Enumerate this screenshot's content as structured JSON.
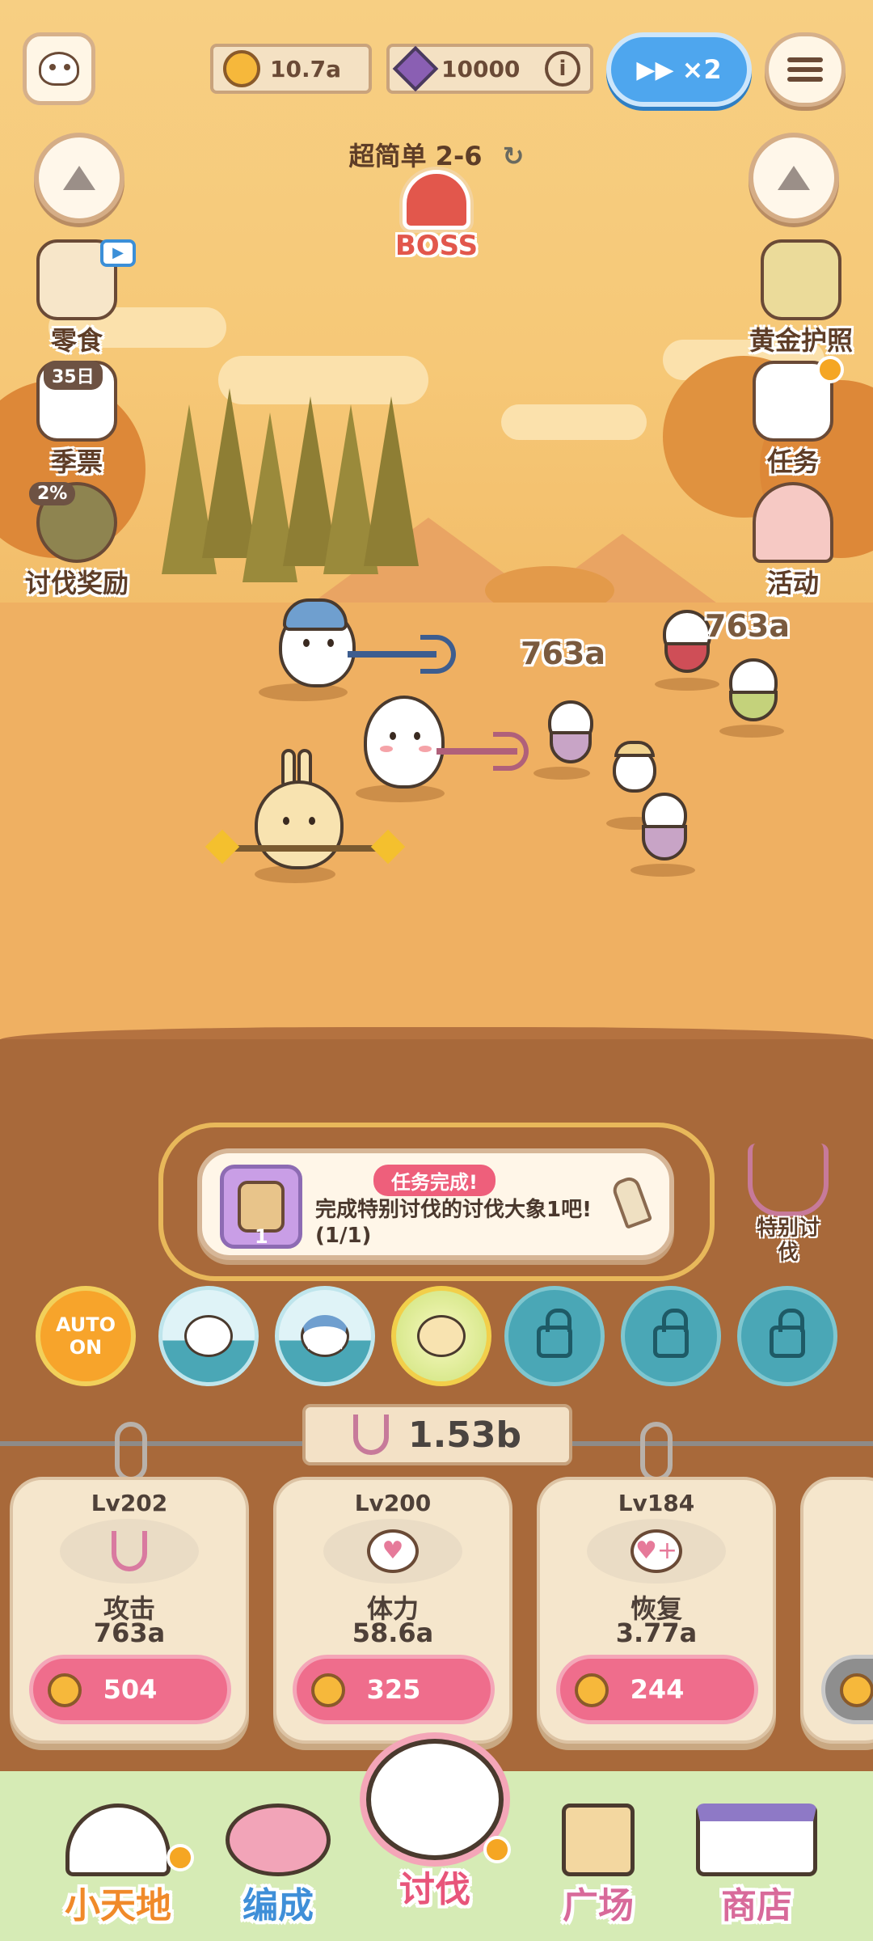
{
  "header": {
    "coins": "10.7a",
    "gems": "10000",
    "speed_label": "×2"
  },
  "stage": {
    "title": "超简单 2-6",
    "boss_label": "BOSS"
  },
  "left_menu": [
    {
      "label": "零食"
    },
    {
      "label": "季票",
      "tag": "35日"
    },
    {
      "label": "讨伐奖励",
      "tag": "2%"
    }
  ],
  "right_menu": [
    {
      "label": "黄金护照"
    },
    {
      "label": "任务"
    },
    {
      "label": "活动"
    }
  ],
  "battle": {
    "damage_numbers": [
      "763a",
      "763a"
    ]
  },
  "mission": {
    "badge": "任务完成!",
    "text": "完成特别讨伐的讨伐大象1吧!(1/1)",
    "icon_count": "1"
  },
  "special_raid": {
    "label": "特别讨伐"
  },
  "skills": {
    "auto_label": "AUTO\nON",
    "auto_line1": "AUTO",
    "auto_line2": "ON"
  },
  "power": {
    "value": "1.53b"
  },
  "upgrades": [
    {
      "level": "Lv202",
      "name": "攻击",
      "value": "763a",
      "cost": "504"
    },
    {
      "level": "Lv200",
      "name": "体力",
      "value": "58.6a",
      "cost": "325"
    },
    {
      "level": "Lv184",
      "name": "恢复",
      "value": "3.77a",
      "cost": "244"
    }
  ],
  "nav": [
    {
      "label": "小天地",
      "color": "#f08a2a"
    },
    {
      "label": "编成",
      "color": "#3f8fd8"
    },
    {
      "label": "讨伐",
      "color": "#e8557a"
    },
    {
      "label": "广场",
      "color": "#d86a9a"
    },
    {
      "label": "商店",
      "color": "#d86a9a"
    }
  ]
}
